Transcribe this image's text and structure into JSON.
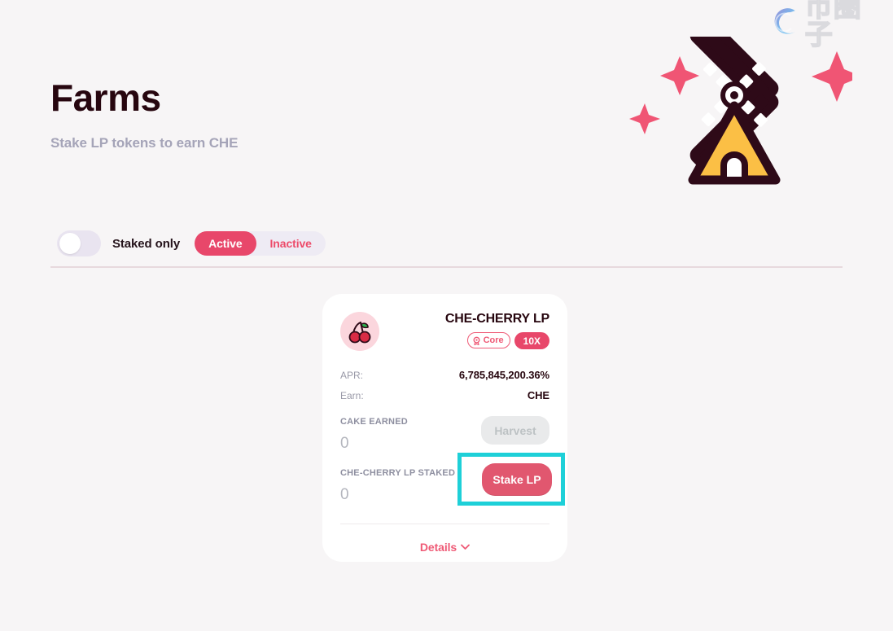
{
  "watermark": {
    "logo_icon": "swirl-c-logo",
    "text": "币圈子"
  },
  "header": {
    "title": "Farms",
    "subtitle": "Stake LP tokens to earn CHE"
  },
  "hero": {
    "art_icon": "windmill-illustration",
    "sparkle_icon": "sparkle-star-icon"
  },
  "controls": {
    "toggle_name": "staked-only-toggle",
    "toggle_state": "off",
    "staked_only_label": "Staked only",
    "tabs": [
      {
        "label": "Active",
        "active": true
      },
      {
        "label": "Inactive",
        "active": false
      }
    ]
  },
  "card": {
    "token_icon": "cherry-icon",
    "pair_name": "CHE-CHERRY LP",
    "badges": {
      "core_label": "Core",
      "core_icon": "award-ribbon-icon",
      "multiplier_label": "10X"
    },
    "apr_key": "APR:",
    "apr_value": "6,785,845,200.36%",
    "earn_key": "Earn:",
    "earn_value": "CHE",
    "earned_label": "CAKE EARNED",
    "earned_value": "0",
    "harvest_label": "Harvest",
    "staked_label": "CHE-CHERRY LP STAKED",
    "staked_value": "0",
    "stake_label": "Stake LP",
    "details_label": "Details",
    "details_icon": "chevron-down-icon"
  },
  "annotation": {
    "highlight_target": "stake-lp-button",
    "highlight_color": "#1ed0d8"
  },
  "colors": {
    "background": "#f7f5f6",
    "accent_red": "#e8476a",
    "accent_pink": "#ef5a76",
    "title_dark": "#27060f",
    "muted": "#a5a4b8",
    "card_white": "#ffffff",
    "windmill_body": "#fbbf45",
    "windmill_dark": "#2e0a18"
  }
}
